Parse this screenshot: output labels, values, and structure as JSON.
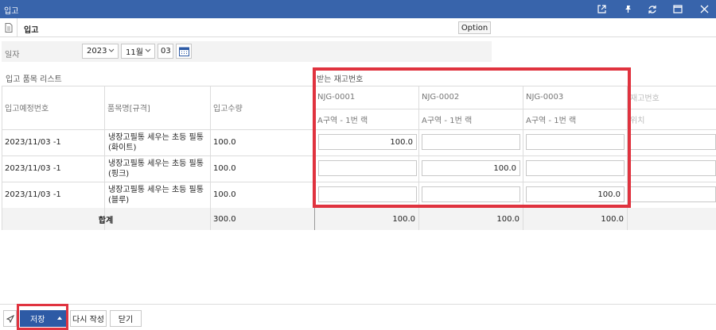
{
  "window": {
    "title": "입고"
  },
  "header": {
    "title": "입고",
    "option_label": "Option"
  },
  "date_filter": {
    "label": "일자",
    "year": "2023",
    "month": "11월",
    "day": "03"
  },
  "sections": {
    "list_title": "입고 품목 리스트",
    "received_title": "받는 재고번호"
  },
  "table": {
    "columns": {
      "plan_no": "입고예정번호",
      "item": "품목명[규격]",
      "qty": "입고수량"
    },
    "stock_columns": [
      {
        "stock_no": "NJG-0001",
        "location": "A구역 - 1번 랙"
      },
      {
        "stock_no": "NJG-0002",
        "location": "A구역 - 1번 랙"
      },
      {
        "stock_no": "NJG-0003",
        "location": "A구역 - 1번 랙"
      }
    ],
    "partial_column": {
      "stock_no": "재고번호",
      "location": "위치"
    },
    "rows": [
      {
        "plan_no": "2023/11/03 -1",
        "item": "냉장고필통 세우는 초등 필통(화이트)",
        "qty": "100.0",
        "alloc": [
          "100.0",
          "",
          ""
        ]
      },
      {
        "plan_no": "2023/11/03 -1",
        "item": "냉장고필통 세우는 초등 필통(핑크)",
        "qty": "100.0",
        "alloc": [
          "",
          "100.0",
          ""
        ]
      },
      {
        "plan_no": "2023/11/03 -1",
        "item": "냉장고필통 세우는 초등 필통(블루)",
        "qty": "100.0",
        "alloc": [
          "",
          "",
          "100.0"
        ]
      }
    ],
    "total": {
      "label": "합계",
      "qty": "300.0",
      "stock_totals": [
        "100.0",
        "100.0",
        "100.0"
      ]
    }
  },
  "footer": {
    "save_label": "저장",
    "rewrite_label": "다시 작성",
    "close_label": "닫기"
  },
  "colors": {
    "titlebar": "#3864ab",
    "primary_button": "#2d5aa5",
    "highlight": "#e0333f"
  }
}
